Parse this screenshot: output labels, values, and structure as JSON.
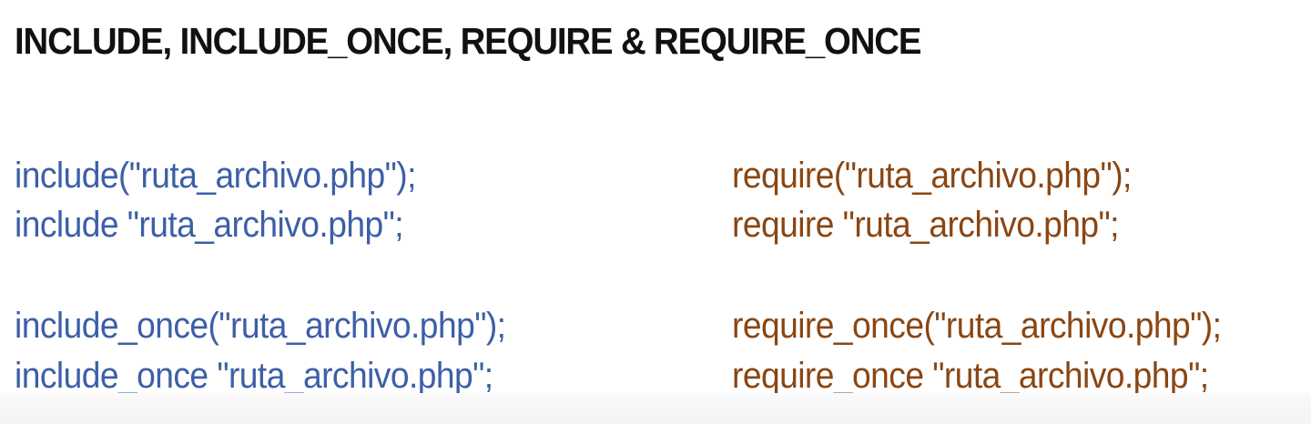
{
  "title": "INCLUDE, INCLUDE_ONCE, REQUIRE & REQUIRE_ONCE",
  "colors": {
    "include": "#3c5fa7",
    "require": "#8a4612",
    "title": "#111111"
  },
  "include_column": {
    "lines": [
      "include(\"ruta_archivo.php\");",
      "include \"ruta_archivo.php\";",
      "include_once(\"ruta_archivo.php\");",
      "include_once \"ruta_archivo.php\";"
    ]
  },
  "require_column": {
    "lines": [
      "require(\"ruta_archivo.php\");",
      "require \"ruta_archivo.php\";",
      "require_once(\"ruta_archivo.php\");",
      "require_once \"ruta_archivo.php\";"
    ]
  }
}
